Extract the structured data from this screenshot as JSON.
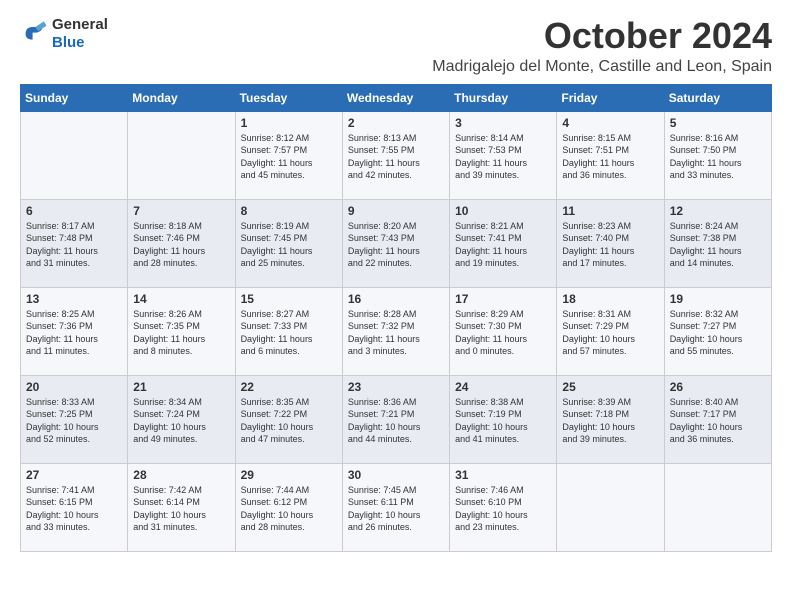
{
  "logo": {
    "general": "General",
    "blue": "Blue"
  },
  "title": "October 2024",
  "subtitle": "Madrigalejo del Monte, Castille and Leon, Spain",
  "headers": [
    "Sunday",
    "Monday",
    "Tuesday",
    "Wednesday",
    "Thursday",
    "Friday",
    "Saturday"
  ],
  "weeks": [
    [
      {
        "day": "",
        "info": ""
      },
      {
        "day": "",
        "info": ""
      },
      {
        "day": "1",
        "info": "Sunrise: 8:12 AM\nSunset: 7:57 PM\nDaylight: 11 hours\nand 45 minutes."
      },
      {
        "day": "2",
        "info": "Sunrise: 8:13 AM\nSunset: 7:55 PM\nDaylight: 11 hours\nand 42 minutes."
      },
      {
        "day": "3",
        "info": "Sunrise: 8:14 AM\nSunset: 7:53 PM\nDaylight: 11 hours\nand 39 minutes."
      },
      {
        "day": "4",
        "info": "Sunrise: 8:15 AM\nSunset: 7:51 PM\nDaylight: 11 hours\nand 36 minutes."
      },
      {
        "day": "5",
        "info": "Sunrise: 8:16 AM\nSunset: 7:50 PM\nDaylight: 11 hours\nand 33 minutes."
      }
    ],
    [
      {
        "day": "6",
        "info": "Sunrise: 8:17 AM\nSunset: 7:48 PM\nDaylight: 11 hours\nand 31 minutes."
      },
      {
        "day": "7",
        "info": "Sunrise: 8:18 AM\nSunset: 7:46 PM\nDaylight: 11 hours\nand 28 minutes."
      },
      {
        "day": "8",
        "info": "Sunrise: 8:19 AM\nSunset: 7:45 PM\nDaylight: 11 hours\nand 25 minutes."
      },
      {
        "day": "9",
        "info": "Sunrise: 8:20 AM\nSunset: 7:43 PM\nDaylight: 11 hours\nand 22 minutes."
      },
      {
        "day": "10",
        "info": "Sunrise: 8:21 AM\nSunset: 7:41 PM\nDaylight: 11 hours\nand 19 minutes."
      },
      {
        "day": "11",
        "info": "Sunrise: 8:23 AM\nSunset: 7:40 PM\nDaylight: 11 hours\nand 17 minutes."
      },
      {
        "day": "12",
        "info": "Sunrise: 8:24 AM\nSunset: 7:38 PM\nDaylight: 11 hours\nand 14 minutes."
      }
    ],
    [
      {
        "day": "13",
        "info": "Sunrise: 8:25 AM\nSunset: 7:36 PM\nDaylight: 11 hours\nand 11 minutes."
      },
      {
        "day": "14",
        "info": "Sunrise: 8:26 AM\nSunset: 7:35 PM\nDaylight: 11 hours\nand 8 minutes."
      },
      {
        "day": "15",
        "info": "Sunrise: 8:27 AM\nSunset: 7:33 PM\nDaylight: 11 hours\nand 6 minutes."
      },
      {
        "day": "16",
        "info": "Sunrise: 8:28 AM\nSunset: 7:32 PM\nDaylight: 11 hours\nand 3 minutes."
      },
      {
        "day": "17",
        "info": "Sunrise: 8:29 AM\nSunset: 7:30 PM\nDaylight: 11 hours\nand 0 minutes."
      },
      {
        "day": "18",
        "info": "Sunrise: 8:31 AM\nSunset: 7:29 PM\nDaylight: 10 hours\nand 57 minutes."
      },
      {
        "day": "19",
        "info": "Sunrise: 8:32 AM\nSunset: 7:27 PM\nDaylight: 10 hours\nand 55 minutes."
      }
    ],
    [
      {
        "day": "20",
        "info": "Sunrise: 8:33 AM\nSunset: 7:25 PM\nDaylight: 10 hours\nand 52 minutes."
      },
      {
        "day": "21",
        "info": "Sunrise: 8:34 AM\nSunset: 7:24 PM\nDaylight: 10 hours\nand 49 minutes."
      },
      {
        "day": "22",
        "info": "Sunrise: 8:35 AM\nSunset: 7:22 PM\nDaylight: 10 hours\nand 47 minutes."
      },
      {
        "day": "23",
        "info": "Sunrise: 8:36 AM\nSunset: 7:21 PM\nDaylight: 10 hours\nand 44 minutes."
      },
      {
        "day": "24",
        "info": "Sunrise: 8:38 AM\nSunset: 7:19 PM\nDaylight: 10 hours\nand 41 minutes."
      },
      {
        "day": "25",
        "info": "Sunrise: 8:39 AM\nSunset: 7:18 PM\nDaylight: 10 hours\nand 39 minutes."
      },
      {
        "day": "26",
        "info": "Sunrise: 8:40 AM\nSunset: 7:17 PM\nDaylight: 10 hours\nand 36 minutes."
      }
    ],
    [
      {
        "day": "27",
        "info": "Sunrise: 7:41 AM\nSunset: 6:15 PM\nDaylight: 10 hours\nand 33 minutes."
      },
      {
        "day": "28",
        "info": "Sunrise: 7:42 AM\nSunset: 6:14 PM\nDaylight: 10 hours\nand 31 minutes."
      },
      {
        "day": "29",
        "info": "Sunrise: 7:44 AM\nSunset: 6:12 PM\nDaylight: 10 hours\nand 28 minutes."
      },
      {
        "day": "30",
        "info": "Sunrise: 7:45 AM\nSunset: 6:11 PM\nDaylight: 10 hours\nand 26 minutes."
      },
      {
        "day": "31",
        "info": "Sunrise: 7:46 AM\nSunset: 6:10 PM\nDaylight: 10 hours\nand 23 minutes."
      },
      {
        "day": "",
        "info": ""
      },
      {
        "day": "",
        "info": ""
      }
    ]
  ]
}
